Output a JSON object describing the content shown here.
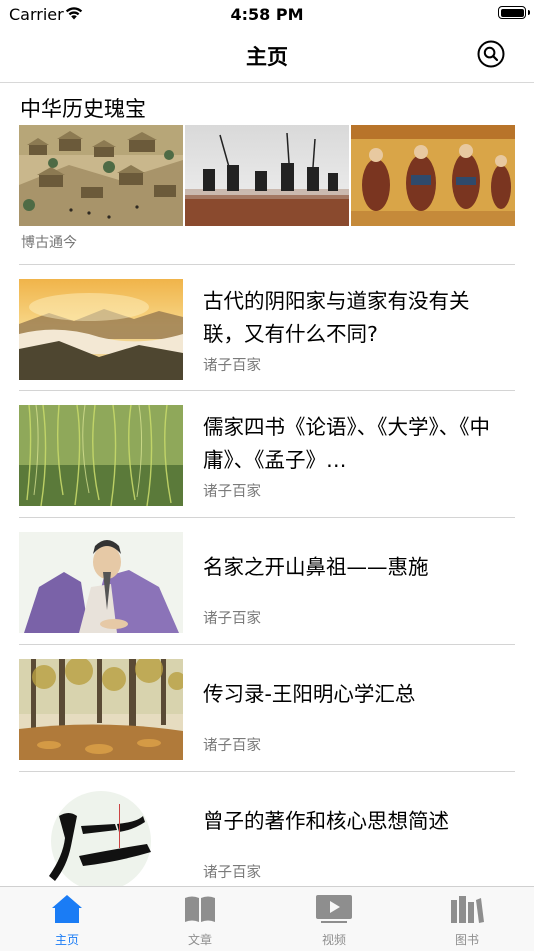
{
  "status_bar": {
    "carrier": "Carrier",
    "time": "4:58 PM"
  },
  "navbar": {
    "title": "主页"
  },
  "featured": {
    "title": "中华历史瑰宝",
    "caption": "博古通今"
  },
  "articles": [
    {
      "title": "古代的阴阳家与道家有没有关联，又有什么不同?",
      "category": "诸子百家"
    },
    {
      "title": "儒家四书《论语》、《大学》、《中庸》、《孟子》…",
      "category": "诸子百家"
    },
    {
      "title": "名家之开山鼻祖——惠施",
      "category": "诸子百家"
    },
    {
      "title": "传习录-王阳明心学汇总",
      "category": "诸子百家"
    },
    {
      "title": "曾子的著作和核心思想简述",
      "category": "诸子百家"
    }
  ],
  "tabbar": {
    "items": [
      {
        "label": "主页",
        "icon": "home-icon",
        "active": true
      },
      {
        "label": "文章",
        "icon": "book-icon",
        "active": false
      },
      {
        "label": "视频",
        "icon": "video-icon",
        "active": false
      },
      {
        "label": "图书",
        "icon": "library-icon",
        "active": false
      }
    ]
  },
  "colors": {
    "accent": "#1a7cf5",
    "secondary_text": "#7a7a7a",
    "divider": "#d4d4d4"
  }
}
